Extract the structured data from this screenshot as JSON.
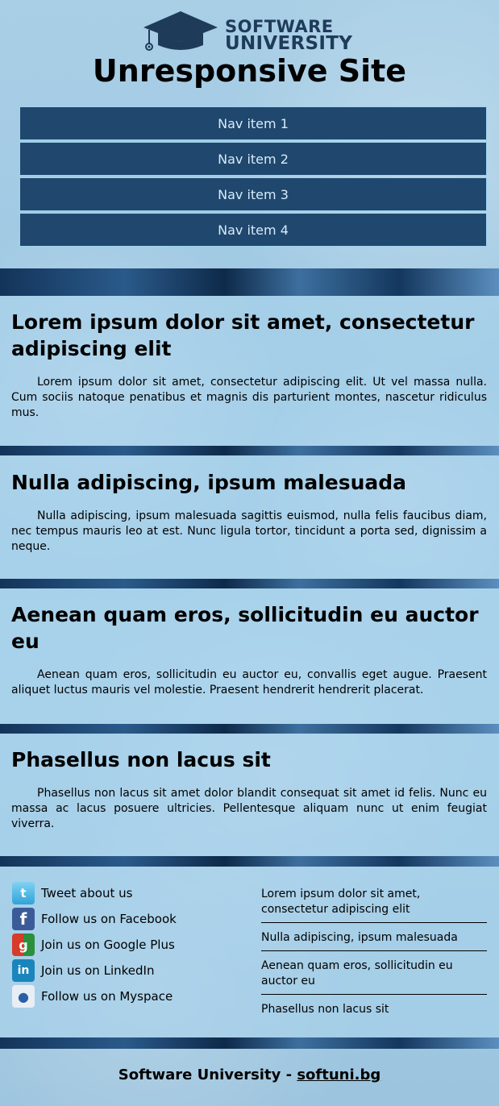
{
  "header": {
    "logo_line1": "SOFTWARE",
    "logo_line2": "UNIVERSITY",
    "site_title": "Unresponsive Site"
  },
  "nav": {
    "items": [
      {
        "label": "Nav item 1"
      },
      {
        "label": "Nav item 2"
      },
      {
        "label": "Nav item 3"
      },
      {
        "label": "Nav item 4"
      }
    ]
  },
  "sections": [
    {
      "title": "Lorem ipsum dolor sit amet, consectetur adipiscing elit",
      "body": "Lorem ipsum dolor sit amet, consectetur adipiscing elit. Ut vel massa nulla. Cum sociis natoque penatibus et magnis dis parturient montes, nascetur ridiculus mus."
    },
    {
      "title": "Nulla adipiscing, ipsum malesuada",
      "body": "Nulla adipiscing, ipsum malesuada sagittis euismod, nulla felis faucibus diam, nec tempus mauris leo at est. Nunc ligula tortor, tincidunt a porta sed, dignissim a neque."
    },
    {
      "title": "Aenean quam eros, sollicitudin eu auctor eu",
      "body": "Aenean quam eros, sollicitudin eu auctor eu, convallis eget augue. Praesent aliquet luctus mauris vel molestie. Praesent hendrerit hendrerit placerat."
    },
    {
      "title": "Phasellus non lacus sit",
      "body": "Phasellus non lacus sit amet dolor blandit consequat sit amet id felis. Nunc eu massa ac lacus posuere ultricies. Pellentesque aliquam nunc ut enim feugiat viverra."
    }
  ],
  "footer": {
    "social": [
      {
        "label": "Tweet about us",
        "icon": "twitter-icon"
      },
      {
        "label": "Follow us on Facebook",
        "icon": "facebook-icon"
      },
      {
        "label": "Join us on Google Plus",
        "icon": "google-plus-icon"
      },
      {
        "label": "Join us on LinkedIn",
        "icon": "linkedin-icon"
      },
      {
        "label": "Follow us on Myspace",
        "icon": "myspace-icon"
      }
    ],
    "links": [
      {
        "label": "Lorem ipsum dolor sit amet, consectetur adipiscing elit"
      },
      {
        "label": "Nulla adipiscing, ipsum malesuada"
      },
      {
        "label": "Aenean quam eros, sollicitudin eu auctor eu"
      },
      {
        "label": "Phasellus non lacus sit"
      }
    ],
    "copyright_prefix": "Software University - ",
    "copyright_link": "softuni.bg"
  },
  "colors": {
    "nav_bg": "#20476d",
    "nav_border": "#9fd3ef",
    "nav_text": "#d6ecfa",
    "logo": "#1f3b5a"
  }
}
